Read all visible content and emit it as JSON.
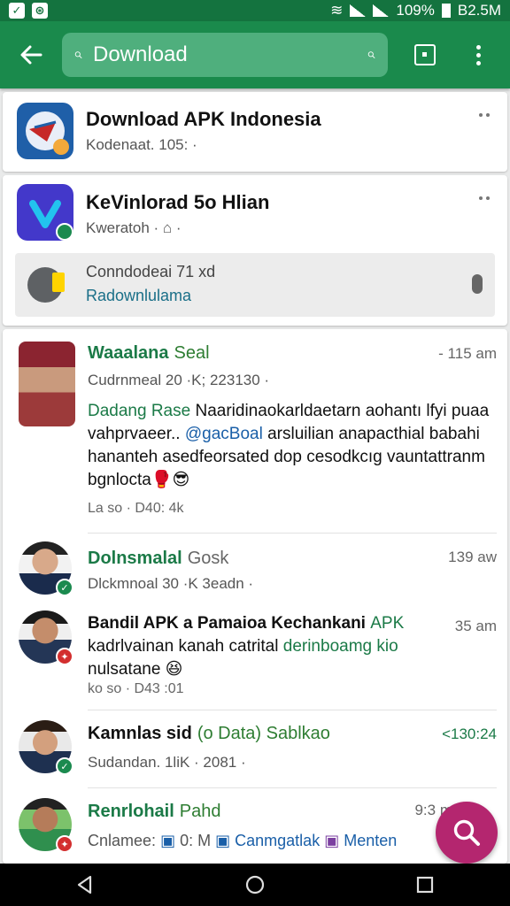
{
  "status_bar": {
    "battery": "109%",
    "data": "B2.5M"
  },
  "search": {
    "value": "Download",
    "placeholder": "Download"
  },
  "apps": [
    {
      "title": "Download APK Indonesia",
      "subtitle": "Kodenaat. 105: ·"
    },
    {
      "title": "KeVinlorad 5o Hlian",
      "subtitle": "Kweratoh · ⌂ ·"
    }
  ],
  "promo": {
    "line1": "Conndodeai 71 xd",
    "line2": "Radownlulama"
  },
  "posts": [
    {
      "name": "Waaalana",
      "name_extra": "Seal",
      "time": "- 115 am",
      "sub": "Cudrnmeal 20 ·K; 223130 ·",
      "body_hl": "Dadang Rase",
      "body_main": " Naaridinaokarldaetarn aohantı ",
      "body_tail": "lfyi puaa vahprvaeer.. ",
      "body_link": "@gacBoal",
      "body_rest": " arsluilian anapacthial babahi hananteh asedfeorsated dop cesodkcıg vauntattranm bgnlocta🥊😎",
      "stats": "La so · D40: 4k",
      "badge_color": "#1b8a4f"
    },
    {
      "name": "Dolnsmalal",
      "name_extra": "Gosk",
      "time": "139 aw",
      "sub": "Dlckmnoal 30 ·K 3eadn ·",
      "badge_color": "#1b8a4f"
    },
    {
      "name": "",
      "time": "35 am",
      "body_main": "Bandil APK a Pamaioa Kechankani ",
      "body_hl": "APK",
      "body_rest": " kadrlvainan kanah catrital ",
      "body_hl2": "derinboamg kio",
      "body_tail": " nulsatane 😆",
      "stats": "ko so · D43 :01",
      "badge_color": "#d32f2f"
    },
    {
      "name": "Kamnlas sid",
      "name_extra": "(o Data) Sablkao",
      "time": "<130:24",
      "sub": "Sudandan. 1liK · 2081 ·",
      "badge_color": "#1b8a4f"
    },
    {
      "name": "Renrlohail",
      "name_extra": "Pahd",
      "time": "9:3 m",
      "sub_a": "Cnlamee:",
      "sub_b": "0: M",
      "sub_c": "Canmgatlak",
      "sub_d": "Menten",
      "badge_color": "#d32f2f"
    }
  ]
}
